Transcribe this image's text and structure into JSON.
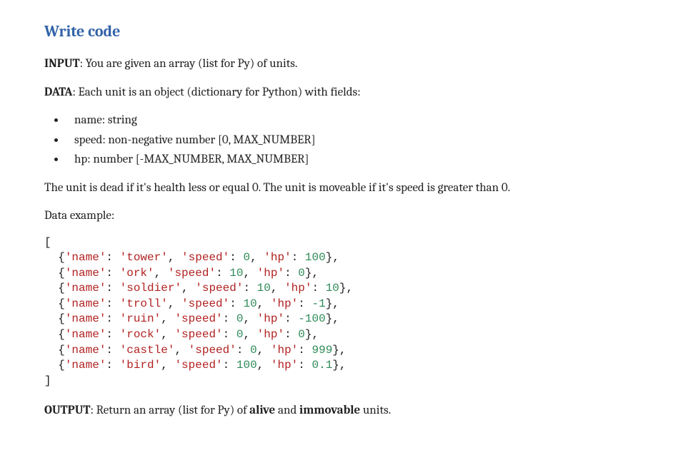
{
  "title": "Write code",
  "input": {
    "prefix": "INPUT",
    "text": ": You are given an array (list for Py) of units."
  },
  "data_section": {
    "prefix": "DATA",
    "text": ": Each unit is an object (dictionary for Python) with fields:"
  },
  "fields": [
    "name: string",
    "speed: non-negative number [0, MAX_NUMBER]",
    "hp: number [-MAX_NUMBER, MAX_NUMBER]"
  ],
  "rules": "The unit is dead if it's health less or equal 0. The unit is moveable if it's speed is greater than 0.",
  "data_example_label": "Data example:",
  "example": [
    {
      "name": "tower",
      "speed": "0",
      "hp": "100"
    },
    {
      "name": "ork",
      "speed": "10",
      "hp": "0"
    },
    {
      "name": "soldier",
      "speed": "10",
      "hp": "10"
    },
    {
      "name": "troll",
      "speed": "10",
      "hp": "-1"
    },
    {
      "name": "ruin",
      "speed": "0",
      "hp": "-100"
    },
    {
      "name": "rock",
      "speed": "0",
      "hp": "0"
    },
    {
      "name": "castle",
      "speed": "0",
      "hp": "999"
    },
    {
      "name": "bird",
      "speed": "100",
      "hp": "0.1"
    }
  ],
  "output": {
    "prefix": "OUTPUT",
    "before": ": Return an array (list for Py) of ",
    "bold1": "alive",
    "mid": " and ",
    "bold2": "immovable",
    "after": " units."
  }
}
